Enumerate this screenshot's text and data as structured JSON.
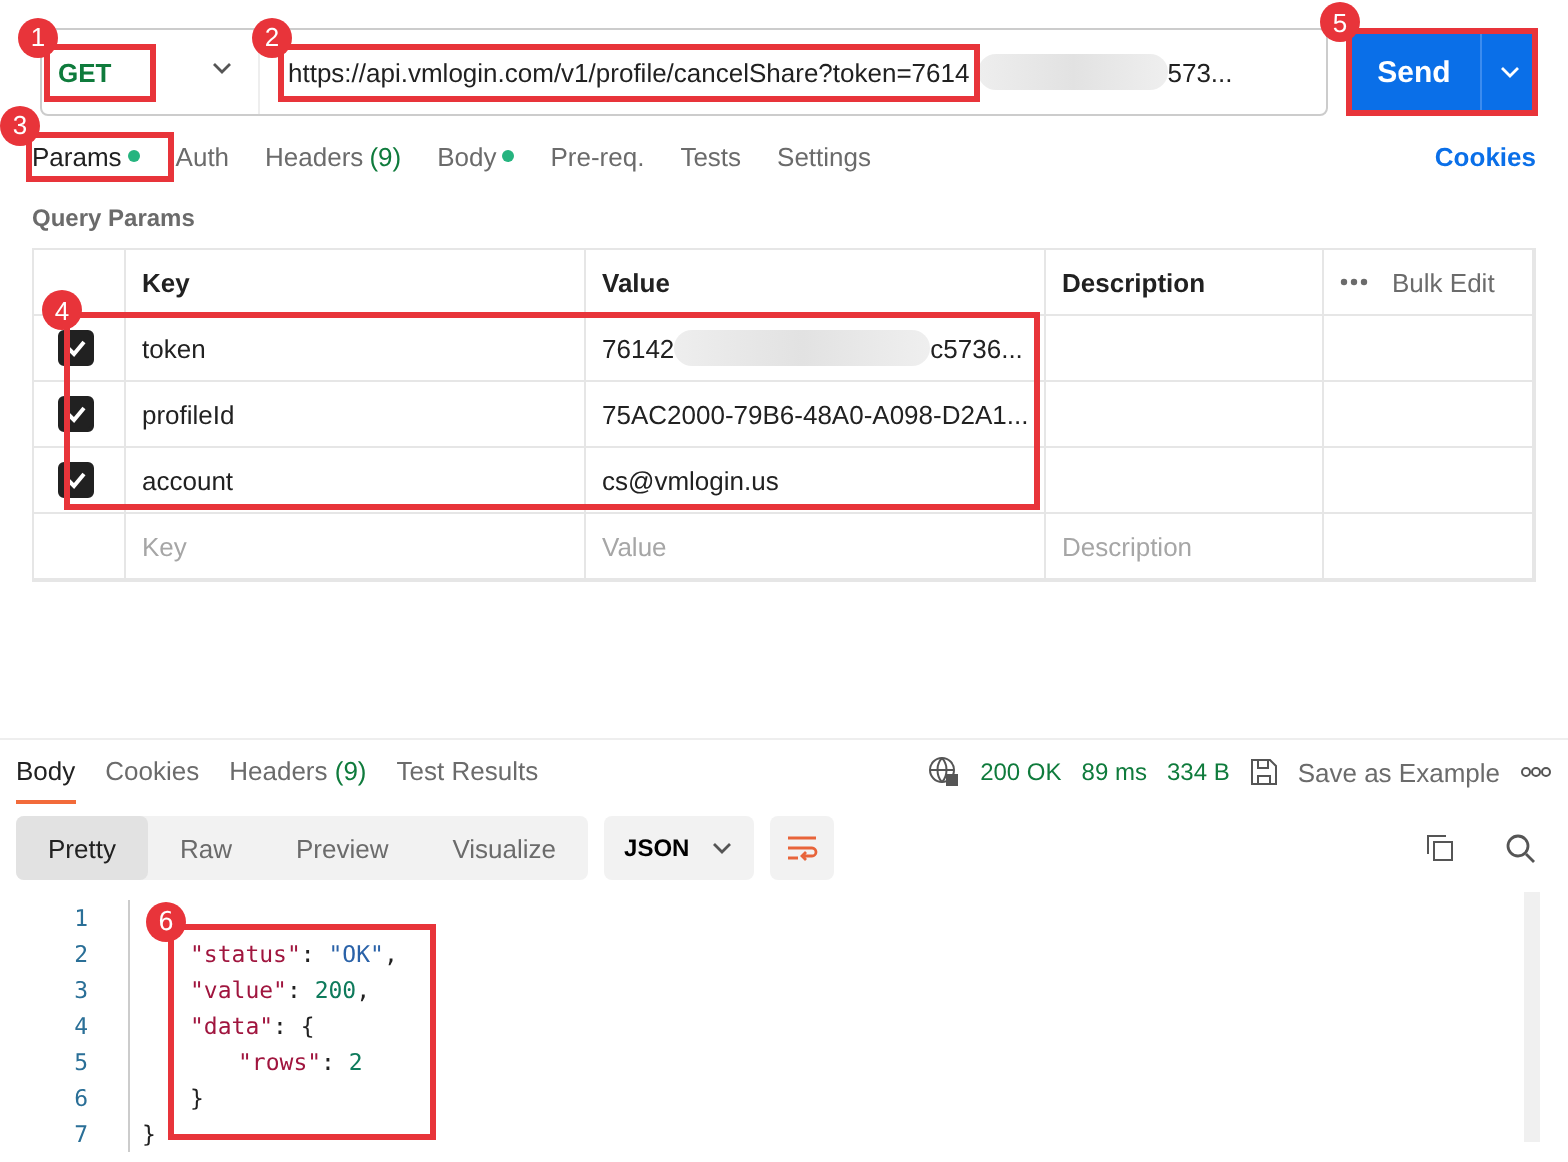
{
  "request": {
    "method": "GET",
    "method_annotation": "1",
    "url_start": "https://api.vmlogin.com/v1/profile/cancelShare?token=7614",
    "url_end": "573...",
    "url_annotation": "2",
    "send": "Send",
    "send_annotation": "5"
  },
  "request_tabs": [
    {
      "label": "Params",
      "selected": true,
      "dot": true,
      "annotation": "3"
    },
    {
      "label": "Auth",
      "selected": false,
      "dot": false
    },
    {
      "label": "Headers",
      "count": "(9)",
      "selected": false,
      "dot": false
    },
    {
      "label": "Body",
      "selected": false,
      "dot": true
    },
    {
      "label": "Pre-req.",
      "selected": false,
      "dot": false
    },
    {
      "label": "Tests",
      "selected": false,
      "dot": false
    },
    {
      "label": "Settings",
      "selected": false,
      "dot": false
    }
  ],
  "cookies_link": "Cookies",
  "query_params": {
    "title": "Query Params",
    "columns": [
      "Key",
      "Value",
      "Description"
    ],
    "bulk_edit": "Bulk Edit",
    "rows_annotation": "4",
    "rows": [
      {
        "checked": true,
        "key": "token",
        "value_start": "76142",
        "value_end": "c5736...",
        "blurred": true
      },
      {
        "checked": true,
        "key": "profileId",
        "value_start": "75AC2000-79B6-48A0-A098-D2A1..."
      },
      {
        "checked": true,
        "key": "account",
        "value_start": "cs@vmlogin.us"
      }
    ],
    "placeholders": {
      "key": "Key",
      "value": "Value",
      "description": "Description"
    }
  },
  "response_tabs": [
    {
      "label": "Body",
      "selected": true
    },
    {
      "label": "Cookies",
      "selected": false
    },
    {
      "label": "Headers",
      "count": "(9)",
      "selected": false
    },
    {
      "label": "Test Results",
      "selected": false
    }
  ],
  "response_meta": {
    "status": "200 OK",
    "time": "89 ms",
    "size": "334 B",
    "save": "Save as Example"
  },
  "view_modes": [
    {
      "label": "Pretty",
      "selected": true
    },
    {
      "label": "Raw",
      "selected": false
    },
    {
      "label": "Preview",
      "selected": false
    },
    {
      "label": "Visualize",
      "selected": false
    }
  ],
  "format": "JSON",
  "code": {
    "annotation": "6",
    "lines": [
      {
        "number": "1"
      },
      {
        "number": "2",
        "tokens": [
          {
            "kind": "key",
            "text": "\"status\""
          },
          {
            "kind": "punct",
            "text": ": "
          },
          {
            "kind": "string",
            "text": "\"OK\""
          },
          {
            "kind": "punct",
            "text": ","
          }
        ]
      },
      {
        "number": "3",
        "tokens": [
          {
            "kind": "key",
            "text": "\"value\""
          },
          {
            "kind": "punct",
            "text": ": "
          },
          {
            "kind": "number",
            "text": "200"
          },
          {
            "kind": "punct",
            "text": ","
          }
        ]
      },
      {
        "number": "4",
        "tokens": [
          {
            "kind": "key",
            "text": "\"data\""
          },
          {
            "kind": "punct",
            "text": ": {"
          }
        ]
      },
      {
        "number": "5",
        "indent": true,
        "tokens": [
          {
            "kind": "key",
            "text": "\"rows\""
          },
          {
            "kind": "punct",
            "text": ": "
          },
          {
            "kind": "number",
            "text": "2"
          }
        ]
      },
      {
        "number": "6",
        "tokens": [
          {
            "kind": "punct",
            "text": "}"
          }
        ]
      },
      {
        "number": "7",
        "outer": true,
        "tokens": [
          {
            "kind": "punct",
            "text": "}"
          }
        ]
      }
    ]
  }
}
